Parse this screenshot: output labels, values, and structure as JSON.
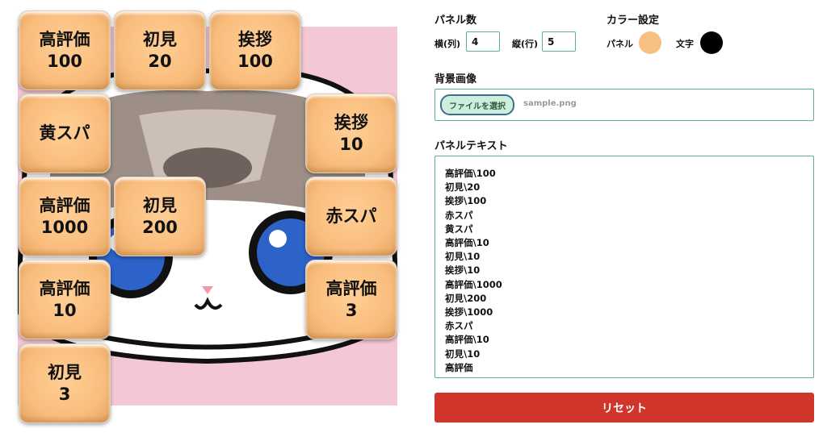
{
  "board": {
    "background_image": "sample.png",
    "background_color": "#f4c7d5",
    "panels": [
      {
        "line1": "高評価",
        "line2": "100"
      },
      {
        "line1": "初見",
        "line2": "20"
      },
      {
        "line1": "挨拶",
        "line2": "100"
      },
      {
        "line1": "黄スパ",
        "line2": ""
      },
      {
        "line1": "挨拶",
        "line2": "10"
      },
      {
        "line1": "高評価",
        "line2": "1000"
      },
      {
        "line1": "初見",
        "line2": "200"
      },
      {
        "line1": "赤スパ",
        "line2": ""
      },
      {
        "line1": "高評価",
        "line2": "10"
      },
      {
        "line1": "高評価",
        "line2": "3"
      },
      {
        "line1": "初見",
        "line2": "3"
      }
    ]
  },
  "settings": {
    "panel_count": {
      "label": "パネル数",
      "cols_label": "横(列)",
      "cols_value": "4",
      "rows_label": "縦(行)",
      "rows_value": "5"
    },
    "color": {
      "label": "カラー設定",
      "panel_label": "パネル",
      "panel_color": "#f7bf82",
      "text_label": "文字",
      "text_color": "#000000"
    },
    "background": {
      "label": "背景画像",
      "button_label": "ファイルを選択",
      "file_name": "sample.png"
    },
    "panel_text": {
      "label": "パネルテキスト",
      "lines": [
        "高評価\\100",
        "初見\\20",
        "挨拶\\100",
        "赤スパ",
        "黄スパ",
        "高評価\\10",
        "初見\\10",
        "挨拶\\10",
        "高評価\\1000",
        "初見\\200",
        "挨拶\\1000",
        "赤スパ",
        "高評価\\10",
        "初見\\10",
        "高評価"
      ]
    },
    "reset_label": "リセット"
  },
  "colors": {
    "accent_border": "#5cb08a",
    "reset_button": "#d0352b",
    "file_button_bg": "#cdeedd"
  }
}
